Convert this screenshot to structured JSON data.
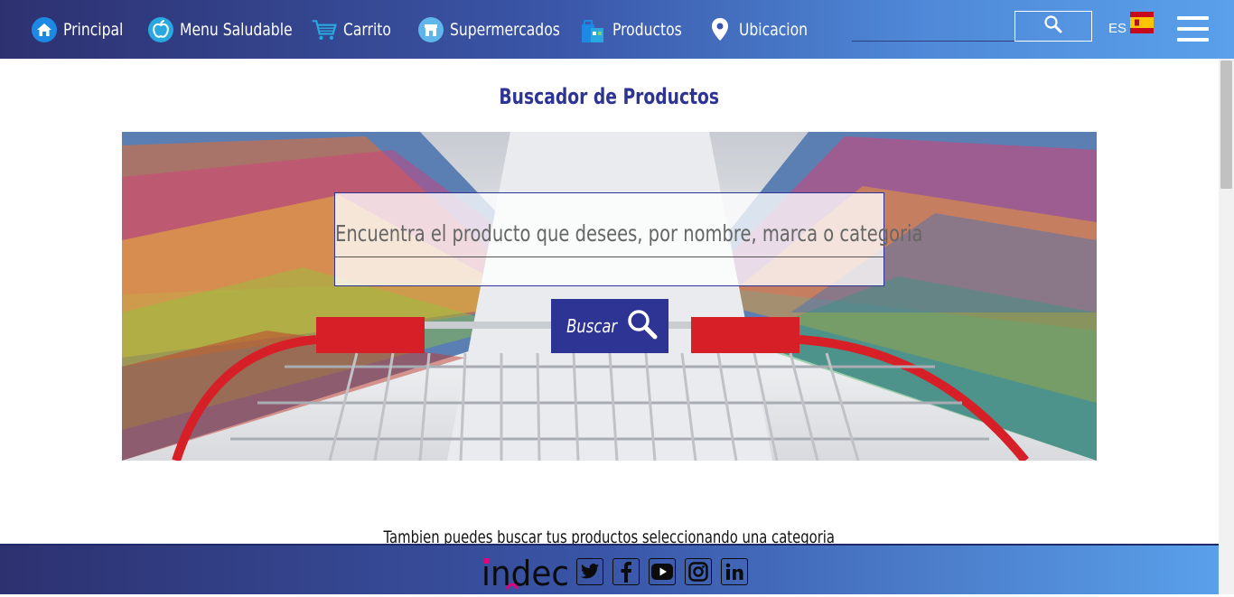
{
  "nav": {
    "items": [
      {
        "label": "Principal",
        "icon": "home-icon"
      },
      {
        "label": "Menu Saludable",
        "icon": "apple-icon"
      },
      {
        "label": "Carrito",
        "icon": "cart-icon"
      },
      {
        "label": "Supermercados",
        "icon": "store-icon"
      },
      {
        "label": "Productos",
        "icon": "bag-icon"
      },
      {
        "label": "Ubicacion",
        "icon": "location-pin-icon"
      }
    ],
    "language": "ES"
  },
  "main": {
    "title": "Buscador de Productos",
    "search_placeholder": "Encuentra el producto que desees, por nombre, marca o categoria",
    "search_button": "Buscar",
    "subtitle": "Tambien puedes buscar tus productos seleccionando una categoria"
  },
  "footer": {
    "logo_text": "indec",
    "social": [
      "twitter-icon",
      "facebook-icon",
      "youtube-icon",
      "instagram-icon",
      "linkedin-icon"
    ]
  },
  "colors": {
    "brand": "#2d3494",
    "nav_start": "#2d3170",
    "nav_end": "#5aa0ea"
  }
}
